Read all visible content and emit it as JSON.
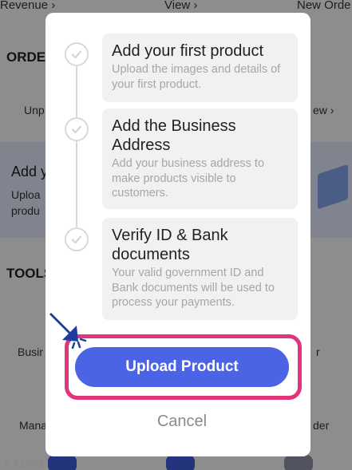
{
  "background": {
    "top_links": [
      "Revenue ›",
      "View ›",
      "New Orde"
    ],
    "orders_title": "ORDE",
    "orders_left": "Unp",
    "orders_right": "ew ›",
    "banner_title": "Add y",
    "banner_line1": "Uploa",
    "banner_line2": "produ",
    "tools_title": "TOOLS",
    "tool_left_1": "Busir",
    "tool_right_1": "r",
    "tool_left_2": "Mana",
    "tool_right_2": "der",
    "watermark": "K 大白网络",
    "colors": {
      "accent": "#3d5bd8",
      "banner": "#dfe3f7"
    }
  },
  "modal": {
    "steps": [
      {
        "title": "Add your first product",
        "description": "Upload the images and details of your first product."
      },
      {
        "title": "Add the Business Address",
        "description": "Add your business address to make products visible to customers."
      },
      {
        "title": "Verify ID & Bank documents",
        "description": "Your valid government ID and Bank documents will be used to process your payments."
      }
    ],
    "primary_button": "Upload Product",
    "secondary_button": "Cancel",
    "colors": {
      "primary": "#4b64e6",
      "highlight": "#e2337e",
      "card": "#f1f1f4"
    },
    "icons": {
      "step_status": "check-circle-icon",
      "pointer": "pointer-arrow-icon"
    }
  }
}
